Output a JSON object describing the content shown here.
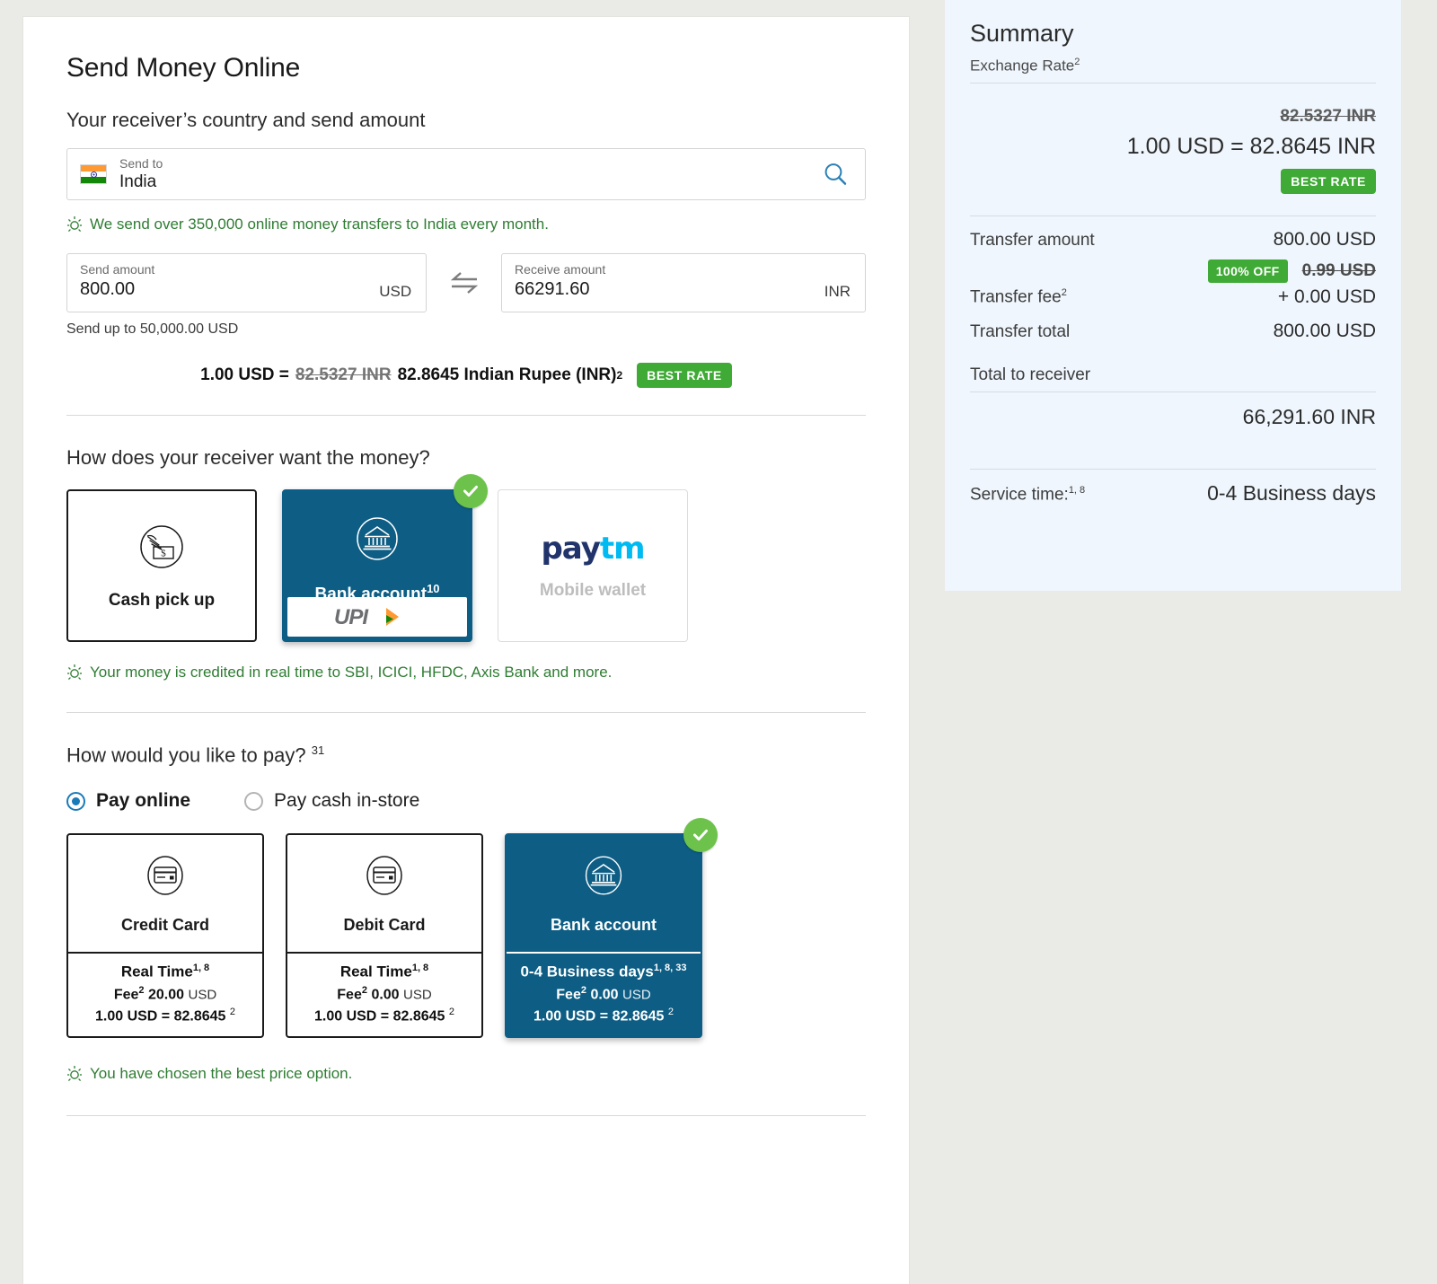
{
  "colors": {
    "brand_blue": "#0d5d84",
    "accent_green": "#3faa35",
    "check_green": "#6cc24a",
    "summary_bg": "#eff6fd",
    "page_bg": "#eaeae6"
  },
  "main": {
    "page_title": "Send Money Online",
    "receiver_section_title": "Your receiver’s country and send amount",
    "country": {
      "label": "Send to",
      "value": "India",
      "flag_alt": "india-flag"
    },
    "tip_country": "We send over 350,000 online money transfers to India every month.",
    "send_amount": {
      "label": "Send amount",
      "value": "800.00",
      "currency": "USD"
    },
    "receive_amount": {
      "label": "Receive amount",
      "value": "66291.60",
      "currency": "INR"
    },
    "send_limit": "Send up to 50,000.00 USD",
    "rate": {
      "prefix": "1.00 USD = ",
      "old": "82.5327 INR",
      "new": "82.8645 Indian Rupee (INR)",
      "footnote": "2",
      "badge": "BEST RATE"
    },
    "receive_method": {
      "heading": "How does your receiver want the money?",
      "options": [
        {
          "label": "Cash pick up",
          "icon": "cash-hand-icon",
          "state": "available",
          "footnote": "",
          "sub_logo": ""
        },
        {
          "label": "Bank account",
          "icon": "bank-icon",
          "state": "selected",
          "footnote": "10",
          "sub_logo": "UPI"
        },
        {
          "label": "Mobile wallet",
          "icon": "paytm-logo",
          "state": "disabled",
          "footnote": "",
          "sub_logo": ""
        }
      ],
      "tip": "Your money is credited in real time to SBI, ICICI, HFDC, Axis Bank and more."
    },
    "payment": {
      "heading": "How would you like to pay?",
      "heading_footnote": "31",
      "radios": [
        {
          "label": "Pay online",
          "selected": true
        },
        {
          "label": "Pay cash in-store",
          "selected": false
        }
      ],
      "cards": [
        {
          "title": "Credit Card",
          "icon": "credit-card-icon",
          "speed": "Real Time",
          "speed_footnote": "1, 8",
          "fee_label": "Fee",
          "fee_footnote": "2",
          "fee_value": "20.00",
          "fee_currency": "USD",
          "rate": "1.00 USD = 82.8645",
          "rate_footnote": "2",
          "selected": false
        },
        {
          "title": "Debit Card",
          "icon": "debit-card-icon",
          "speed": "Real Time",
          "speed_footnote": "1, 8",
          "fee_label": "Fee",
          "fee_footnote": "2",
          "fee_value": "0.00",
          "fee_currency": "USD",
          "rate": "1.00 USD = 82.8645",
          "rate_footnote": "2",
          "selected": false
        },
        {
          "title": "Bank account",
          "icon": "bank-icon",
          "speed": "0-4 Business days",
          "speed_footnote": "1, 8, 33",
          "fee_label": "Fee",
          "fee_footnote": "2",
          "fee_value": "0.00",
          "fee_currency": "USD",
          "rate": "1.00 USD = 82.8645",
          "rate_footnote": "2",
          "selected": true
        }
      ],
      "tip": "You have chosen the best price option."
    }
  },
  "summary": {
    "title": "Summary",
    "exchange_rate_label": "Exchange Rate",
    "exchange_rate_footnote": "2",
    "rate_old": "82.5327 INR",
    "rate_new": "1.00 USD = 82.8645 INR",
    "best_rate_badge": "BEST RATE",
    "transfer_amount_label": "Transfer amount",
    "transfer_amount_value": "800.00 USD",
    "discount_badge": "100% OFF",
    "old_fee": "0.99 USD",
    "transfer_fee_label": "Transfer fee",
    "transfer_fee_footnote": "2",
    "transfer_fee_value": "+ 0.00 USD",
    "transfer_total_label": "Transfer total",
    "transfer_total_value": "800.00 USD",
    "total_to_receiver_label": "Total  to receiver",
    "total_to_receiver_value": "66,291.60 INR",
    "service_time_label": "Service time:",
    "service_time_footnote": "1, 8",
    "service_time_value": "0-4 Business days"
  }
}
